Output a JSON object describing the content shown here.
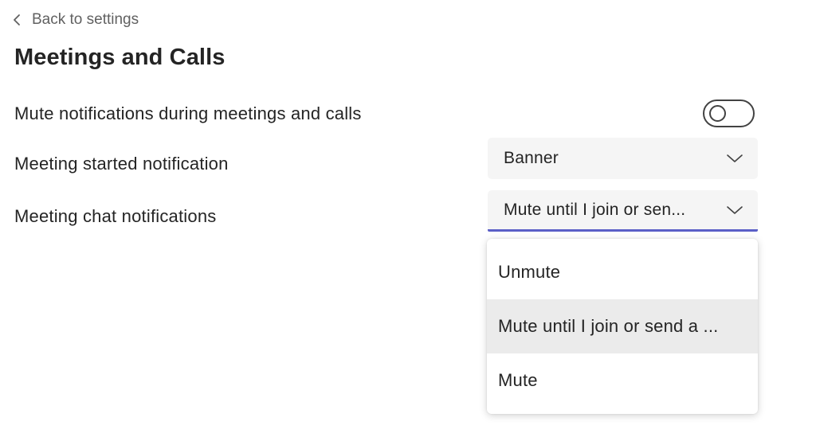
{
  "nav": {
    "back_label": "Back to settings"
  },
  "page": {
    "title": "Meetings and Calls"
  },
  "settings": {
    "mute_during_meetings": {
      "label": "Mute notifications during meetings and calls",
      "enabled": false
    },
    "meeting_started": {
      "label": "Meeting started notification",
      "value": "Banner"
    },
    "meeting_chat": {
      "label": "Meeting chat notifications",
      "value": "Mute until I join or sen..."
    }
  },
  "dropdown": {
    "options": [
      {
        "label": "Unmute"
      },
      {
        "label": "Mute until I join or send a ...",
        "selected": true
      },
      {
        "label": "Mute"
      }
    ]
  },
  "icons": {
    "back": "chevron-left-icon",
    "dropdown": "chevron-down-icon"
  },
  "colors": {
    "accent": "#5b5fc7",
    "selected_option_bg": "#ebebeb",
    "field_bg": "#f5f5f5"
  }
}
